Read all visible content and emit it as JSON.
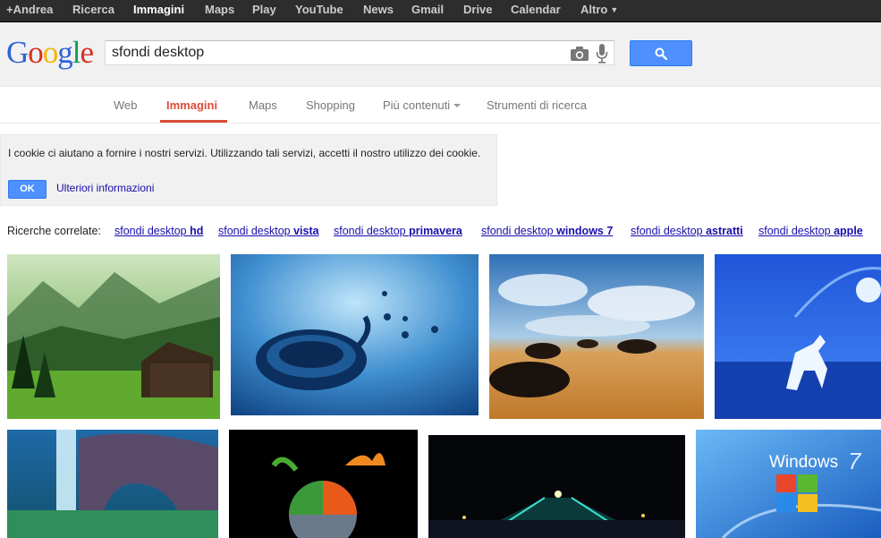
{
  "topbar": {
    "items": [
      "+Andrea",
      "Ricerca",
      "Immagini",
      "Maps",
      "Play",
      "YouTube",
      "News",
      "Gmail",
      "Drive",
      "Calendar",
      "Altro"
    ]
  },
  "logo": {
    "letters": [
      "G",
      "o",
      "o",
      "g",
      "l",
      "e"
    ],
    "colors": [
      "#2f63d8",
      "#d93025",
      "#f4b400",
      "#2f63d8",
      "#0f9d58",
      "#d93025"
    ]
  },
  "search": {
    "value": "sfondi desktop",
    "camera_icon": "camera-icon",
    "mic_icon": "microphone-icon",
    "button_icon": "search-icon"
  },
  "nav": {
    "tabs": [
      "Web",
      "Immagini",
      "Maps",
      "Shopping",
      "Più contenuti",
      "Strumenti di ricerca"
    ],
    "active": "Immagini",
    "accent": "#dd4b39"
  },
  "cookie": {
    "message": "I cookie ci aiutano a fornire i nostri servizi. Utilizzando tali servizi, accetti il nostro utilizzo dei cookie.",
    "ok_label": "OK",
    "more_label": "Ulteriori informazioni"
  },
  "related": {
    "label": "Ricerche correlate:",
    "items": [
      {
        "prefix": "sfondi desktop ",
        "bold": "hd"
      },
      {
        "prefix": "sfondi desktop ",
        "bold": "vista"
      },
      {
        "prefix": "sfondi desktop ",
        "bold": "primavera"
      },
      {
        "prefix": "sfondi desktop ",
        "bold": "windows 7"
      },
      {
        "prefix": "sfondi desktop ",
        "bold": "astratti"
      },
      {
        "prefix": "sfondi desktop ",
        "bold": "apple"
      }
    ]
  },
  "thumb_text": {
    "windows7": "Windows"
  },
  "colors": {
    "link": "#1a0dab",
    "button_blue": "#4d90fe"
  }
}
